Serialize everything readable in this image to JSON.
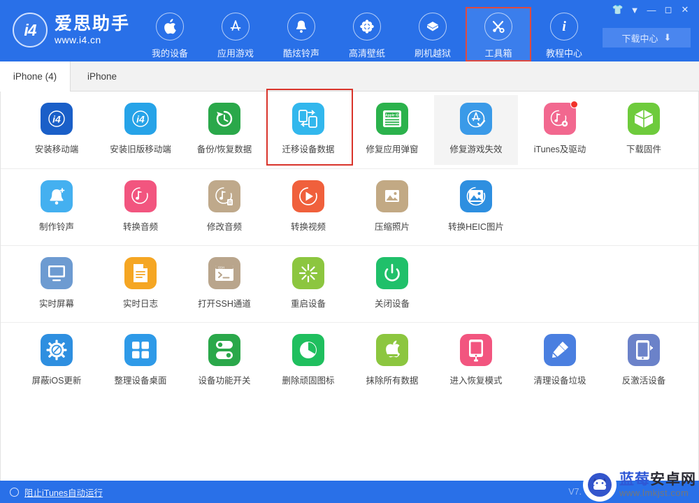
{
  "brand": {
    "name": "爱思助手",
    "url": "www.i4.cn",
    "logo_icon": "i4-logo-icon"
  },
  "header": {
    "nav": [
      {
        "label": "我的设备",
        "icon": "apple-icon",
        "active": false
      },
      {
        "label": "应用游戏",
        "icon": "appstore-icon",
        "active": false
      },
      {
        "label": "酷炫铃声",
        "icon": "bell-icon",
        "active": false
      },
      {
        "label": "高清壁纸",
        "icon": "flower-icon",
        "active": false
      },
      {
        "label": "刷机越狱",
        "icon": "box-open-icon",
        "active": false
      },
      {
        "label": "工具箱",
        "icon": "tools-icon",
        "active": true
      },
      {
        "label": "教程中心",
        "icon": "info-icon",
        "active": false
      }
    ],
    "download_center": {
      "label": "下载中心",
      "icon": "download-icon"
    },
    "window_buttons": [
      {
        "name": "skin-icon",
        "glyph": "👕"
      },
      {
        "name": "menu-dropdown-icon",
        "glyph": "▼"
      },
      {
        "name": "minimize-icon",
        "glyph": "—"
      },
      {
        "name": "maximize-icon",
        "glyph": "◻"
      },
      {
        "name": "close-icon",
        "glyph": "✕"
      }
    ]
  },
  "tabs": [
    {
      "label": "iPhone (4)",
      "active": true
    },
    {
      "label": "iPhone",
      "active": false
    }
  ],
  "toolbox": {
    "rows": [
      [
        {
          "label": "安装移动端",
          "icon": "i4-app-icon",
          "color": "#1a5fc8",
          "selected": false,
          "hover": false,
          "badge": false
        },
        {
          "label": "安装旧版移动端",
          "icon": "i4-app-old-icon",
          "color": "#26a3e8",
          "selected": false,
          "hover": false,
          "badge": false
        },
        {
          "label": "备份/恢复数据",
          "icon": "backup-restore-icon",
          "color": "#2aa84a",
          "selected": false,
          "hover": false,
          "badge": false
        },
        {
          "label": "迁移设备数据",
          "icon": "migrate-data-icon",
          "color": "#32b7ed",
          "selected": true,
          "hover": false,
          "badge": false
        },
        {
          "label": "修复应用弹窗",
          "icon": "apple-id-card-icon",
          "color": "#2bb24c",
          "selected": false,
          "hover": false,
          "badge": false
        },
        {
          "label": "修复游戏失效",
          "icon": "appstore-check-icon",
          "color": "#3a9ae8",
          "selected": false,
          "hover": true,
          "badge": false
        },
        {
          "label": "iTunes及驱动",
          "icon": "itunes-driver-icon",
          "color": "#f2688f",
          "selected": false,
          "hover": false,
          "badge": true
        },
        {
          "label": "下载固件",
          "icon": "firmware-box-icon",
          "color": "#6ecb3c",
          "selected": false,
          "hover": false,
          "badge": false
        }
      ],
      [
        {
          "label": "制作铃声",
          "icon": "ringtone-make-icon",
          "color": "#44b0f0",
          "selected": false,
          "hover": false,
          "badge": false
        },
        {
          "label": "转换音频",
          "icon": "audio-convert-icon",
          "color": "#f2557f",
          "selected": false,
          "hover": false,
          "badge": false
        },
        {
          "label": "修改音频",
          "icon": "audio-edit-icon",
          "color": "#bfa98b",
          "selected": false,
          "hover": false,
          "badge": false
        },
        {
          "label": "转换视频",
          "icon": "video-convert-icon",
          "color": "#f0603c",
          "selected": false,
          "hover": false,
          "badge": false
        },
        {
          "label": "压缩照片",
          "icon": "photo-compress-icon",
          "color": "#c2a984",
          "selected": false,
          "hover": false,
          "badge": false
        },
        {
          "label": "转换HEIC图片",
          "icon": "heic-convert-icon",
          "color": "#2e8fe0",
          "selected": false,
          "hover": false,
          "badge": false
        }
      ],
      [
        {
          "label": "实时屏幕",
          "icon": "live-screen-icon",
          "color": "#6d9bd1",
          "selected": false,
          "hover": false,
          "badge": false
        },
        {
          "label": "实时日志",
          "icon": "live-log-icon",
          "color": "#f5a623",
          "selected": false,
          "hover": false,
          "badge": false
        },
        {
          "label": "打开SSH通道",
          "icon": "ssh-terminal-icon",
          "color": "#b9a58c",
          "selected": false,
          "hover": false,
          "badge": false
        },
        {
          "label": "重启设备",
          "icon": "restart-device-icon",
          "color": "#8cc63f",
          "selected": false,
          "hover": false,
          "badge": false
        },
        {
          "label": "关闭设备",
          "icon": "power-off-icon",
          "color": "#20c06a",
          "selected": false,
          "hover": false,
          "badge": false
        }
      ],
      [
        {
          "label": "屏蔽iOS更新",
          "icon": "block-ios-update-icon",
          "color": "#2e8fe0",
          "selected": false,
          "hover": false,
          "badge": false
        },
        {
          "label": "整理设备桌面",
          "icon": "organize-desktop-icon",
          "color": "#2e9ae8",
          "selected": false,
          "hover": false,
          "badge": false
        },
        {
          "label": "设备功能开关",
          "icon": "feature-toggle-icon",
          "color": "#2aa84a",
          "selected": false,
          "hover": false,
          "badge": false
        },
        {
          "label": "删除顽固图标",
          "icon": "delete-icon-icon",
          "color": "#1fbf5e",
          "selected": false,
          "hover": false,
          "badge": false
        },
        {
          "label": "抹除所有数据",
          "icon": "erase-all-icon",
          "color": "#8cc63f",
          "selected": false,
          "hover": false,
          "badge": false
        },
        {
          "label": "进入恢复模式",
          "icon": "recovery-mode-icon",
          "color": "#f2557f",
          "selected": false,
          "hover": false,
          "badge": false
        },
        {
          "label": "清理设备垃圾",
          "icon": "clean-junk-icon",
          "color": "#4a7fe0",
          "selected": false,
          "hover": false,
          "badge": false
        },
        {
          "label": "反激活设备",
          "icon": "deactivate-device-icon",
          "color": "#6b82c9",
          "selected": false,
          "hover": false,
          "badge": false
        }
      ]
    ]
  },
  "statusbar": {
    "toggle_label": "阻止iTunes自动运行",
    "version": "V7."
  },
  "watermark": {
    "title_blue": "蓝莓",
    "title_dark": "安卓网",
    "url": "www.lmkjst.com",
    "logo_icon": "android-robot-icon"
  },
  "colors": {
    "header_blue": "#2970e8",
    "selection_red": "#d9342b",
    "badge_red": "#f2322a"
  }
}
